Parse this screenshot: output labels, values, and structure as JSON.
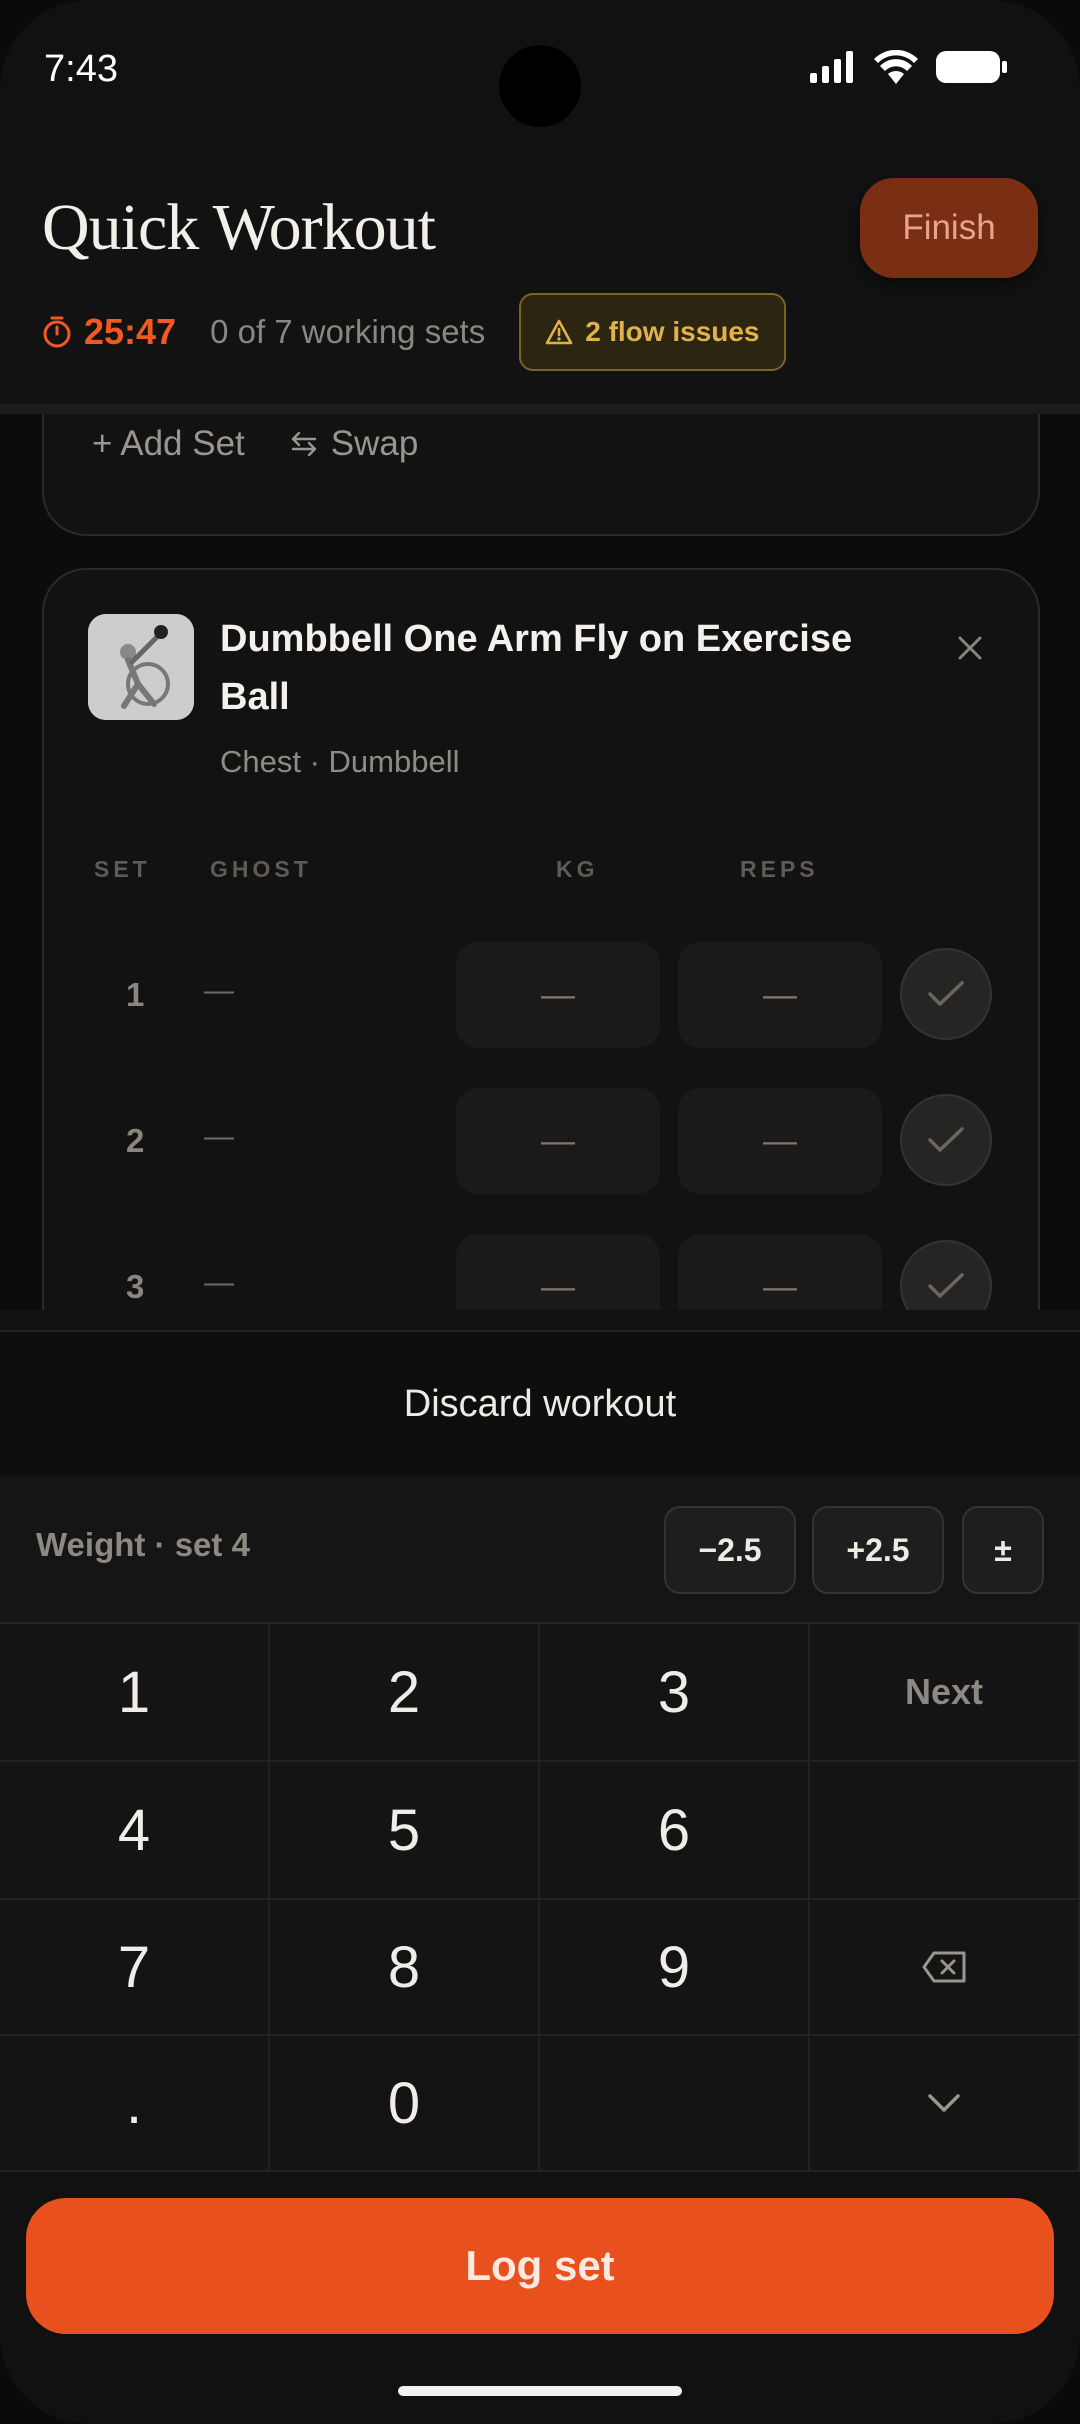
{
  "status_bar": {
    "time": "7:43"
  },
  "header": {
    "title": "Quick Workout",
    "finish_label": "Finish",
    "timer": "25:47",
    "sets_progress": "0 of 7 working sets",
    "flow_issues": "2 flow issues"
  },
  "previous_card": {
    "add_set_label": "+ Add Set",
    "swap_label": "Swap"
  },
  "exercise": {
    "name": "Dumbbell One Arm Fly on Exercise Ball",
    "subtitle": "Chest · Dumbbell",
    "columns": {
      "set": "SET",
      "ghost": "GHOST",
      "kg": "KG",
      "reps": "REPS"
    },
    "sets": [
      {
        "num": "1",
        "ghost": "—",
        "kg": "—",
        "reps": "—"
      },
      {
        "num": "2",
        "ghost": "—",
        "kg": "—",
        "reps": "—"
      },
      {
        "num": "3",
        "ghost": "—",
        "kg": "—",
        "reps": "—"
      }
    ]
  },
  "sheet": {
    "discard_label": "Discard workout",
    "keypad_label": "Weight · set 4",
    "minus_label": "−2.5",
    "plus_label": "+2.5",
    "sign_label": "±",
    "next_label": "Next",
    "keys": [
      "1",
      "2",
      "3",
      "4",
      "5",
      "6",
      "7",
      "8",
      "9",
      ".",
      "0"
    ],
    "log_label": "Log set"
  },
  "colors": {
    "accent": "#e8511e",
    "warning": "#e2b24a",
    "background": "#111111"
  }
}
